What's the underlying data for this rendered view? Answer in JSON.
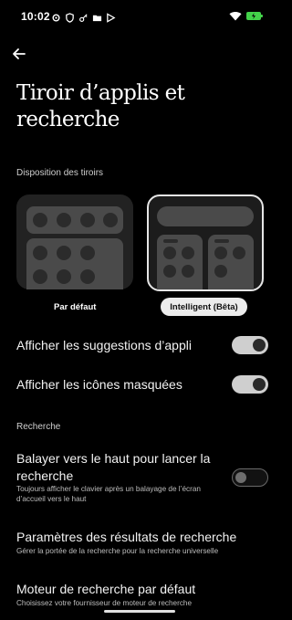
{
  "status": {
    "time": "10:02",
    "icons": [
      "settings-gear-icon",
      "shield-icon",
      "vpn-key-icon",
      "folder-icon",
      "play-store-icon"
    ],
    "right_icons": [
      "wifi-icon",
      "battery-charging-icon"
    ],
    "battery_color": "#43d24a"
  },
  "header": {
    "back_icon": "arrow-left-icon"
  },
  "page": {
    "title": "Tiroir d’applis et recherche"
  },
  "layout_section": {
    "label": "Disposition des tiroirs",
    "options": [
      {
        "label": "Par défaut",
        "selected": false
      },
      {
        "label": "Intelligent (Bêta)",
        "selected": true
      }
    ]
  },
  "toggles": [
    {
      "label": "Afficher les suggestions d’appli",
      "on": true
    },
    {
      "label": "Afficher les icônes masquées",
      "on": true
    }
  ],
  "search_section": {
    "label": "Recherche",
    "items": [
      {
        "title": "Balayer vers le haut pour lancer la recherche",
        "subtitle": "Toujours afficher le clavier après un balayage de l’écran d’accueil vers le haut",
        "on": false
      },
      {
        "title": "Paramètres des résultats de recherche",
        "subtitle": "Gérer la portée de la recherche pour la recherche universelle"
      },
      {
        "title": "Moteur de recherche par défaut",
        "subtitle": "Choisissez votre fournisseur de moteur de recherche"
      }
    ]
  }
}
